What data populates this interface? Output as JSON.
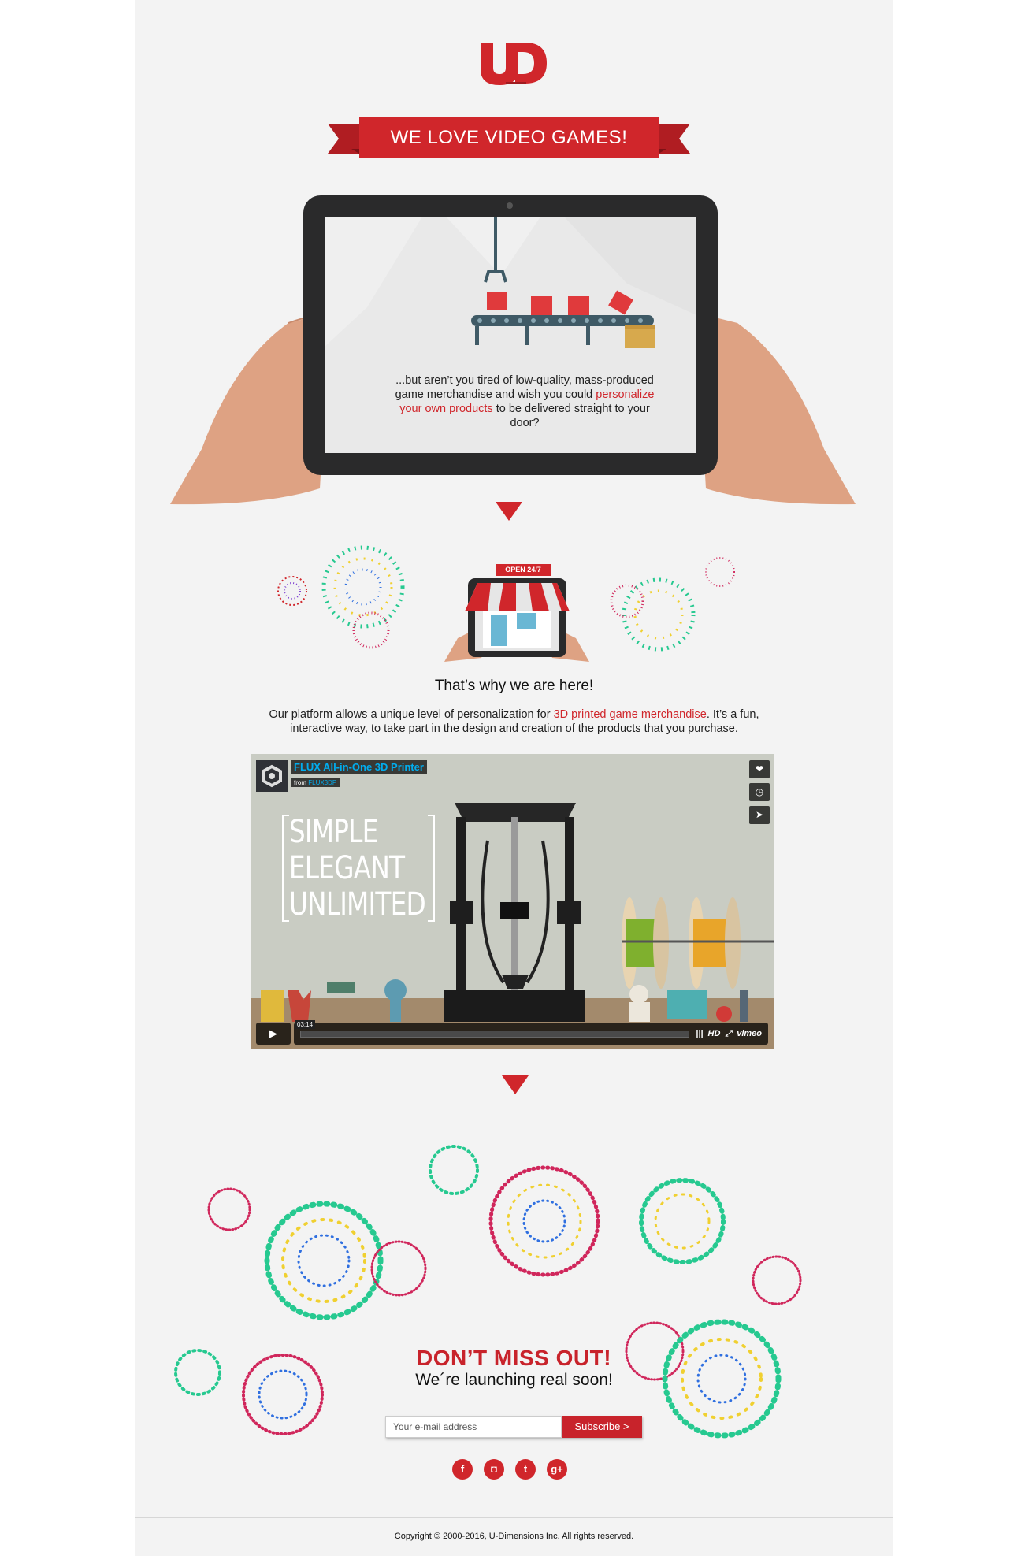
{
  "brand": {
    "logo_text": "UD",
    "accent_color": "#d0262b"
  },
  "banner": {
    "title": "WE LOVE VIDEO GAMES!"
  },
  "hero": {
    "text_before": "...but aren’t you tired of low-quality, mass-produced game merchandise and wish you could ",
    "text_highlight": "personalize your own products",
    "text_after": " to be delivered straight to your door?"
  },
  "store": {
    "sign": "OPEN 24/7"
  },
  "why": {
    "title": "That’s why we are here!",
    "text_before": "Our platform allows a unique level of personalization for ",
    "text_highlight": "3D printed game merchandise",
    "text_after": ". It’s a fun, interactive way, to take part in the design and creation of the products that you purchase."
  },
  "video": {
    "title": "FLUX All-in-One 3D Printer",
    "from_label": "from",
    "from_user": "FLUX3DP",
    "overlay_lines": [
      "SIMPLE",
      "ELEGANT",
      "UNLIMITED"
    ],
    "time": "03:14",
    "hd_label": "HD",
    "brand_label": "vimeo",
    "side_icons": [
      "heart-icon",
      "clock-icon",
      "send-icon"
    ]
  },
  "signup": {
    "headline": "DON’T MISS OUT!",
    "subheadline": "We´re launching real soon!",
    "email_placeholder": "Your e-mail address",
    "subscribe_label": "Subscribe  >"
  },
  "social": [
    {
      "name": "facebook-icon",
      "glyph": "f"
    },
    {
      "name": "instagram-icon",
      "glyph": "◘"
    },
    {
      "name": "twitter-icon",
      "glyph": "t"
    },
    {
      "name": "googleplus-icon",
      "glyph": "g+"
    }
  ],
  "footer": {
    "copyright": "Copyright © 2000-2016, U-Dimensions Inc. All rights reserved."
  }
}
